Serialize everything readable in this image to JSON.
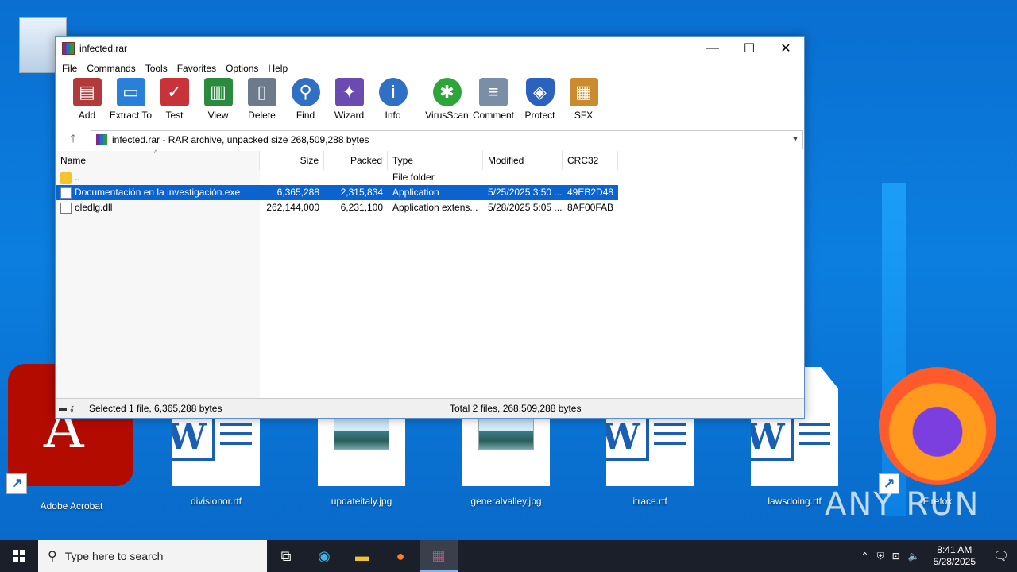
{
  "window": {
    "title": "infected.rar",
    "minimize": "—",
    "maximize": "☐",
    "close": "✕"
  },
  "menu": [
    "File",
    "Commands",
    "Tools",
    "Favorites",
    "Options",
    "Help"
  ],
  "toolbar": [
    {
      "label": "Add",
      "icon": "add-icon",
      "color": "#b33a3a"
    },
    {
      "label": "Extract To",
      "icon": "extract-icon",
      "color": "#2a7fd8"
    },
    {
      "label": "Test",
      "icon": "test-icon",
      "color": "#c8333a"
    },
    {
      "label": "View",
      "icon": "view-icon",
      "color": "#2b8a3e"
    },
    {
      "label": "Delete",
      "icon": "delete-icon",
      "color": "#6b7b8c"
    },
    {
      "label": "Find",
      "icon": "find-icon",
      "color": "#2f6fc4"
    },
    {
      "label": "Wizard",
      "icon": "wizard-icon",
      "color": "#6b4bb0"
    },
    {
      "label": "Info",
      "icon": "info-icon",
      "color": "#2f6fc4"
    },
    {
      "label": "VirusScan",
      "icon": "virusscan-icon",
      "color": "#2ea43b"
    },
    {
      "label": "Comment",
      "icon": "comment-icon",
      "color": "#7a8ea6"
    },
    {
      "label": "Protect",
      "icon": "protect-icon",
      "color": "#2b62c0"
    },
    {
      "label": "SFX",
      "icon": "sfx-icon",
      "color": "#c98b2e"
    }
  ],
  "address": {
    "text": "infected.rar - RAR archive, unpacked size 268,509,288 bytes"
  },
  "columns": [
    "Name",
    "Size",
    "Packed",
    "Type",
    "Modified",
    "CRC32"
  ],
  "files": [
    {
      "name": "..",
      "size": "",
      "packed": "",
      "type": "File folder",
      "modified": "",
      "crc": "",
      "icon": "folder-icon"
    },
    {
      "name": "Documentación en la investigación.exe",
      "size": "6,365,288",
      "packed": "2,315,834",
      "type": "Application",
      "modified": "5/25/2025 3:50 ...",
      "crc": "49EB2D48",
      "icon": "exe-icon"
    },
    {
      "name": "oledlg.dll",
      "size": "262,144,000",
      "packed": "6,231,100",
      "type": "Application extens...",
      "modified": "5/28/2025 5:05 ...",
      "crc": "8AF00FAB",
      "icon": "dll-icon"
    }
  ],
  "status": {
    "left": "Selected 1 file, 6,365,288 bytes",
    "right": "Total 2 files, 268,509,288 bytes"
  },
  "desktop": [
    {
      "label": "Adobe Acrobat",
      "icon": "adobe-acrobat-icon"
    },
    {
      "label": "divisionor.rtf",
      "icon": "word-document-icon"
    },
    {
      "label": "updateitaly.jpg",
      "icon": "image-file-icon"
    },
    {
      "label": "generalvalley.jpg",
      "icon": "image-file-icon"
    },
    {
      "label": "itrace.rtf",
      "icon": "word-document-icon"
    },
    {
      "label": "lawsdoing.rtf",
      "icon": "word-document-icon"
    },
    {
      "label": "Firefox",
      "icon": "firefox-icon"
    }
  ],
  "taskbar": {
    "search_placeholder": "Type here to search",
    "time": "8:41 AM",
    "date": "5/28/2025"
  },
  "watermark": "ANY RUN"
}
